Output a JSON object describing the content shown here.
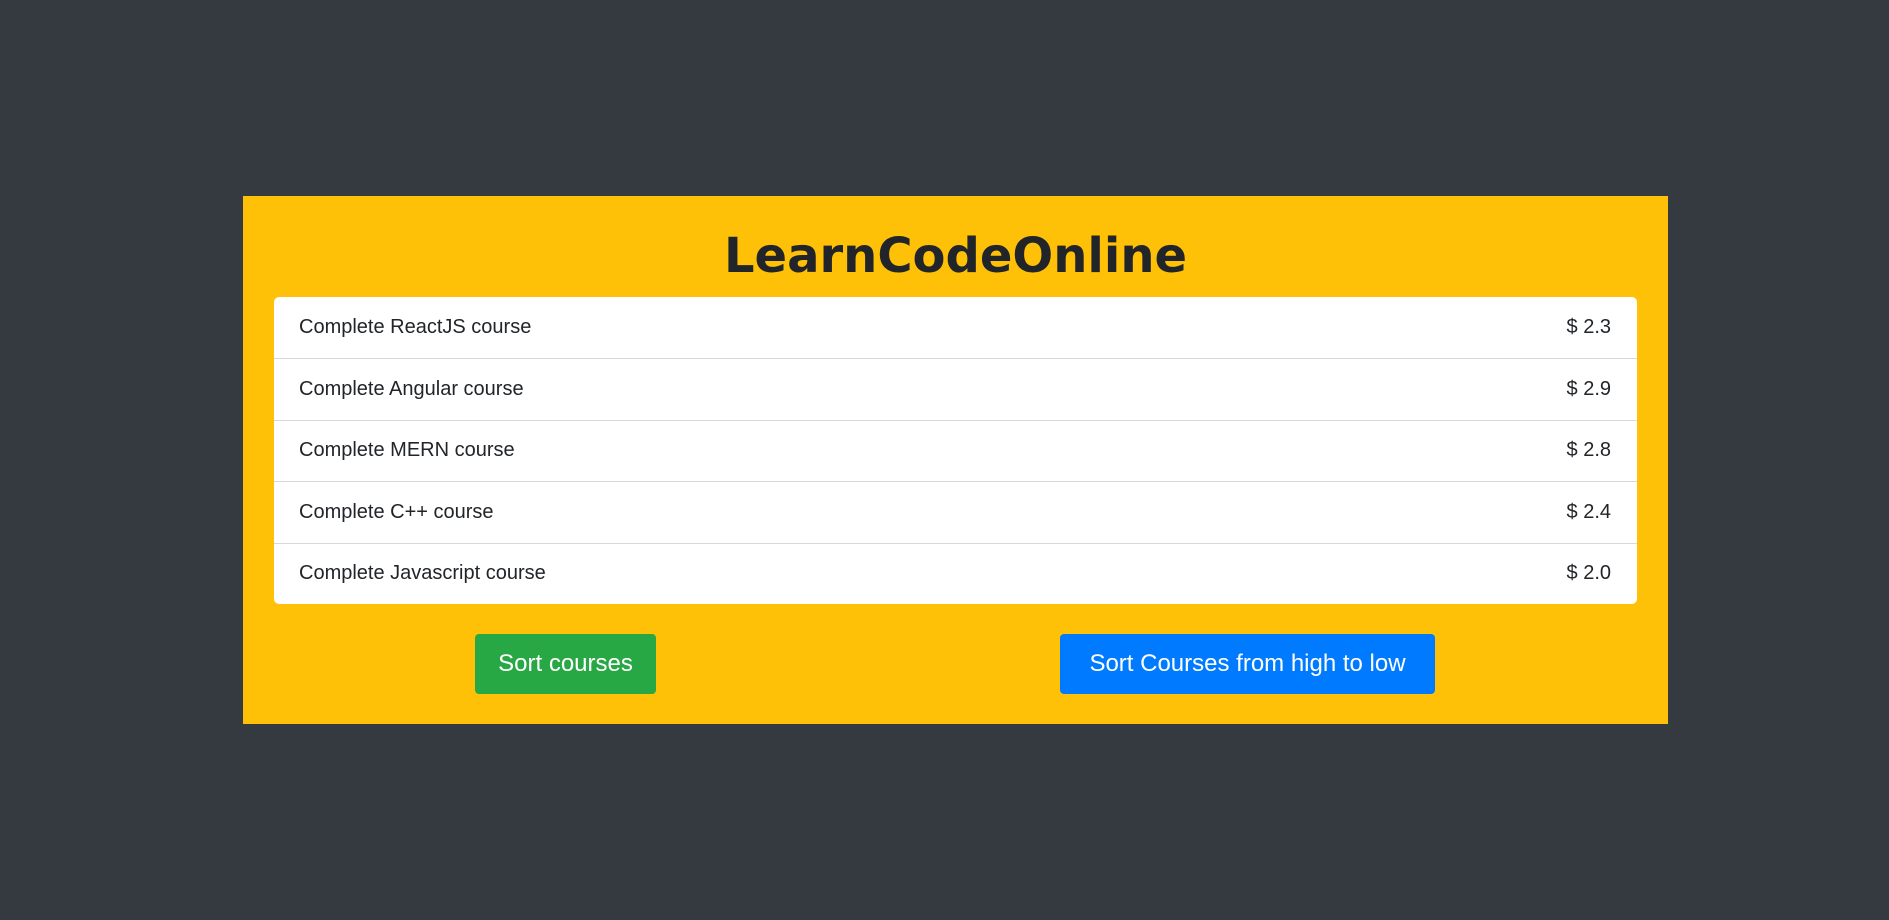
{
  "app": {
    "title": "LearnCodeOnline"
  },
  "courses": [
    {
      "name": "Complete ReactJS course",
      "price": "$ 2.3"
    },
    {
      "name": "Complete Angular course",
      "price": "$ 2.9"
    },
    {
      "name": "Complete MERN course",
      "price": "$ 2.8"
    },
    {
      "name": "Complete C++ course",
      "price": "$ 2.4"
    },
    {
      "name": "Complete Javascript course",
      "price": "$ 2.0"
    }
  ],
  "actions": {
    "sort_label": "Sort courses",
    "sort_desc_label": "Sort Courses from high to low"
  },
  "colors": {
    "background": "#343a40",
    "panel": "#ffc107",
    "sort_button": "#28a745",
    "sort_desc_button": "#007bff"
  }
}
